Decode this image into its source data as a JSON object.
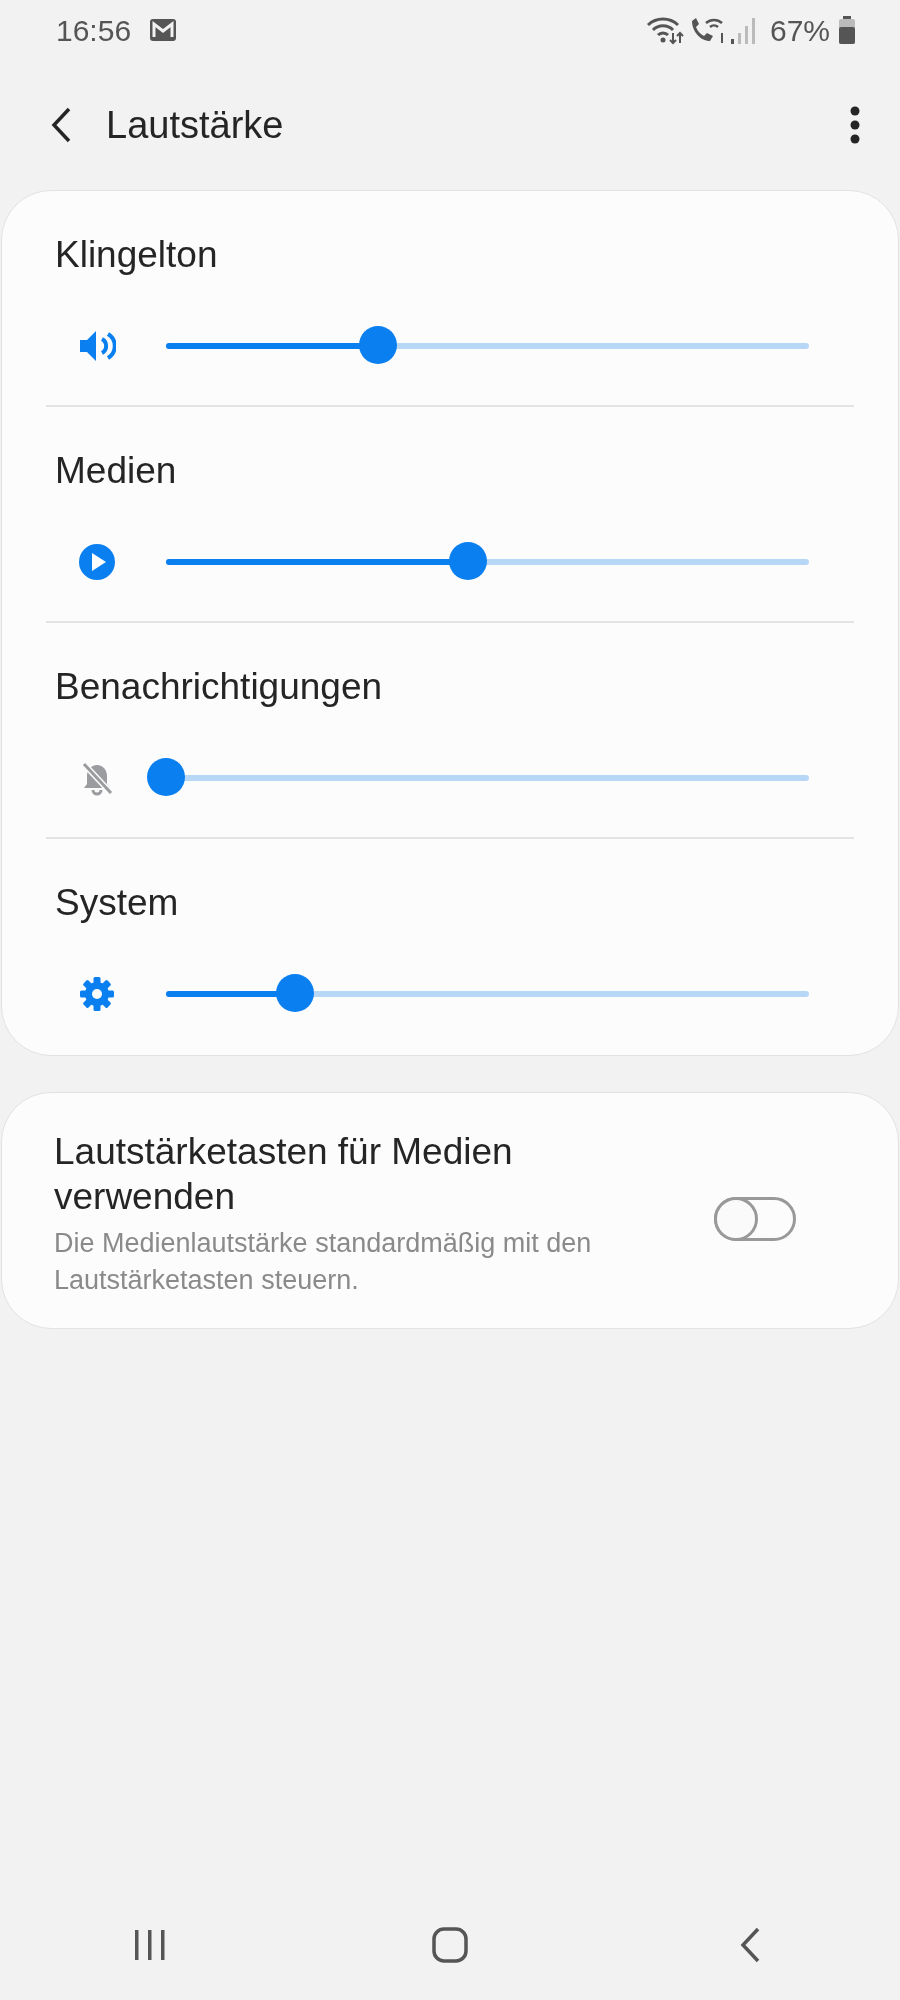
{
  "status_bar": {
    "time": "16:56",
    "battery": "67%"
  },
  "header": {
    "title": "Lautstärke"
  },
  "channels": [
    {
      "name": "Klingelton",
      "muted": false,
      "level": 0.33
    },
    {
      "name": "Medien",
      "muted": false,
      "level": 0.47
    },
    {
      "name": "Benachrichtigungen",
      "muted": true,
      "level": 0
    },
    {
      "name": "System",
      "muted": false,
      "level": 0.2
    }
  ],
  "setting": {
    "title": "Lautstärketasten für Medien verwenden",
    "description": "Die Medienlautstärke standardmäßig mit den Lautstärketasten steuern.",
    "on": false
  }
}
